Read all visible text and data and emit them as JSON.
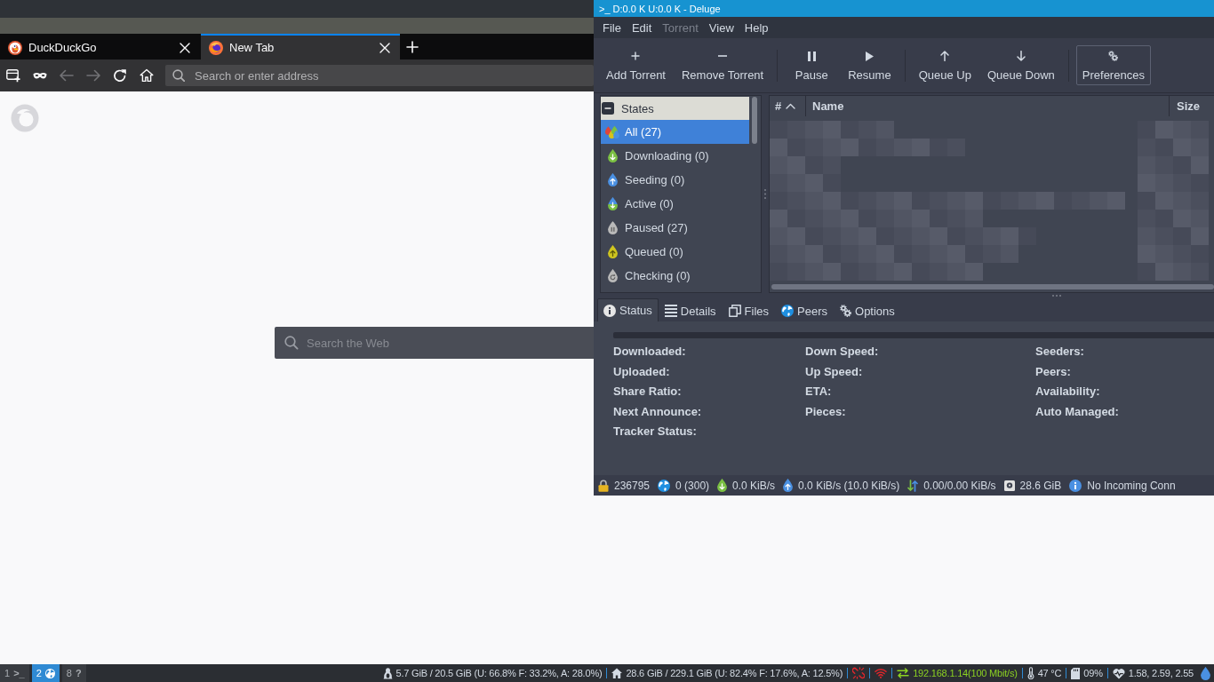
{
  "browser": {
    "tabs": [
      {
        "title": "DuckDuckGo",
        "selected": false
      },
      {
        "title": "New Tab",
        "selected": true
      }
    ],
    "nav_buttons": [
      {
        "disabled": false
      },
      {
        "disabled": false
      },
      {
        "disabled": true
      },
      {
        "disabled": true
      },
      {
        "disabled": false
      },
      {
        "disabled": false
      }
    ],
    "address_bar": {
      "placeholder": "Search or enter address"
    },
    "page": {
      "search": {
        "placeholder": "Search the Web"
      }
    }
  },
  "deluge": {
    "window": {
      "title": ">_ D:0.0 K U:0.0 K - Deluge"
    },
    "menu": [
      {
        "label": "File",
        "disabled": false
      },
      {
        "label": "Edit",
        "disabled": false
      },
      {
        "label": "Torrent",
        "disabled": true
      },
      {
        "label": "View",
        "disabled": false
      },
      {
        "label": "Help",
        "disabled": false
      }
    ],
    "toolbar": [
      {
        "buttons": [
          {
            "label": "Add Torrent",
            "focused": false
          },
          {
            "label": "Remove Torrent",
            "focused": false
          }
        ]
      },
      {
        "buttons": [
          {
            "label": "Pause",
            "focused": false
          },
          {
            "label": "Resume",
            "focused": false
          }
        ]
      },
      {
        "buttons": [
          {
            "label": "Queue Up",
            "focused": false
          },
          {
            "label": "Queue Down",
            "focused": false
          }
        ]
      },
      {
        "buttons": [
          {
            "label": "Preferences",
            "focused": true
          }
        ]
      }
    ],
    "sidebar": {
      "header": "States",
      "expanded": true,
      "items": [
        {
          "label": "All (27)",
          "selected": true
        },
        {
          "label": "Downloading (0)",
          "selected": false
        },
        {
          "label": "Seeding (0)",
          "selected": false
        },
        {
          "label": "Active (0)",
          "selected": false
        },
        {
          "label": "Paused (27)",
          "selected": false
        },
        {
          "label": "Queued (0)",
          "selected": false
        },
        {
          "label": "Checking (0)",
          "selected": false
        }
      ]
    },
    "torrent_table": {
      "columns": [
        {
          "label": "#",
          "sorted": true
        },
        {
          "label": "Name",
          "sorted": false
        },
        {
          "label": "Size",
          "sorted": false
        }
      ]
    },
    "details_tabs": [
      {
        "label": "Status",
        "selected": true
      },
      {
        "label": "Details",
        "selected": false
      },
      {
        "label": "Files",
        "selected": false
      },
      {
        "label": "Peers",
        "selected": false
      },
      {
        "label": "Options",
        "selected": false
      }
    ],
    "status_panel": {
      "columns": [
        [
          "Downloaded:",
          "Uploaded:",
          "Share Ratio:",
          "Next Announce:",
          "Tracker Status:"
        ],
        [
          "Down Speed:",
          "Up Speed:",
          "ETA:",
          "Pieces:"
        ],
        [
          "Seeders:",
          "Peers:",
          "Availability:",
          "Auto Managed:"
        ]
      ]
    },
    "status_bar": [
      "236795",
      "0 (300)",
      "0.0 KiB/s",
      "0.0 KiB/s (10.0 KiB/s)",
      "0.00/0.00 KiB/s",
      "28.6 GiB",
      "No Incoming Conn"
    ]
  },
  "taskbar": {
    "workspaces": [
      {
        "label": "1",
        "glyph": ">_",
        "selected": false
      },
      {
        "label": "2",
        "selected": true
      },
      {
        "label": "8",
        "glyph": "?",
        "selected": false
      }
    ],
    "status": [
      {
        "text": "5.7 GiB / 20.5 GiB (U: 66.8% F: 33.2%, A: 28.0%)",
        "color": "#d3dae3"
      },
      {
        "text": "28.6 GiB / 229.1 GiB (U: 82.4% F: 17.6%, A: 12.5%)",
        "color": "#d3dae3"
      },
      {
        "color": "#e0262b"
      },
      {
        "color": "#e0262b"
      },
      {
        "text": "192.168.1.14(100 Mbit/s)",
        "color": "#8bd122"
      },
      {
        "text": "47 °C",
        "color": "#d3dae3"
      },
      {
        "text": "09%",
        "color": "#d3dae3"
      },
      {
        "text": "1.58, 2.59, 2.55",
        "color": "#d3dae3"
      }
    ]
  }
}
